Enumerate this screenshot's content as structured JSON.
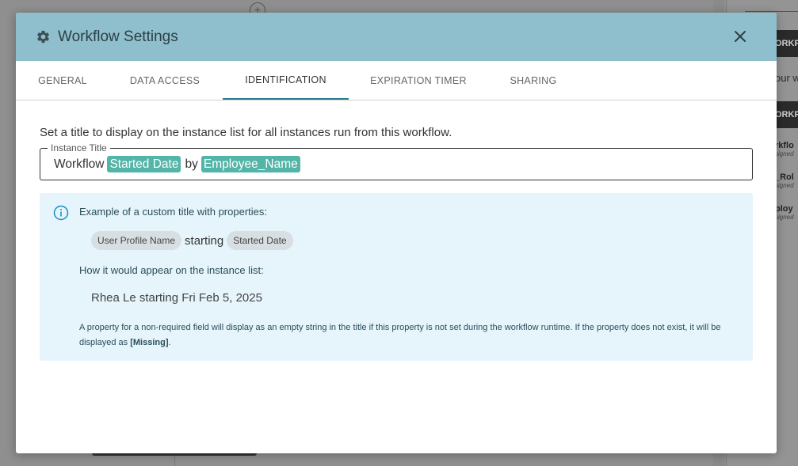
{
  "background": {
    "panel_texts": [
      "ORKFLO",
      "our w",
      "ORKF"
    ],
    "side_items": [
      {
        "title": "rkflo",
        "subtitle": "signed"
      },
      {
        "title": "_Rol",
        "subtitle": "signed"
      },
      {
        "title": "ploy",
        "subtitle": "signed"
      }
    ]
  },
  "modal": {
    "title": "Workflow Settings",
    "icon": "gear-icon",
    "close_icon": "close-icon"
  },
  "tabs": [
    {
      "label": "GENERAL"
    },
    {
      "label": "DATA ACCESS"
    },
    {
      "label": "IDENTIFICATION",
      "active": true
    },
    {
      "label": "EXPIRATION TIMER"
    },
    {
      "label": "SHARING"
    }
  ],
  "identification": {
    "intro": "Set a title to display on the instance list for all instances run from this workflow.",
    "field_label": "Instance Title",
    "title_parts": {
      "text1": "Workflow",
      "chip1": "Started Date",
      "text2": "by",
      "chip2": "Employee_Name"
    },
    "info": {
      "heading": "Example of a custom title with properties:",
      "example_chip1": "User Profile Name",
      "example_word": "starting",
      "example_chip2": "Started Date",
      "appear_label": "How it would appear on the instance list:",
      "appear_example": "Rhea Le starting Fri Feb 5, 2025",
      "note_text": "A property for a non-required field will display as an empty string in the title if this property is not set during the workflow runtime. If the property does not exist, it will be displayed as",
      "note_missing": "[Missing]",
      "note_end": "."
    }
  },
  "colors": {
    "header": "#8fbfcc",
    "chip": "#52b5a7",
    "info_bg": "#e6f5fb",
    "active_tab": "#2a7d8f"
  }
}
